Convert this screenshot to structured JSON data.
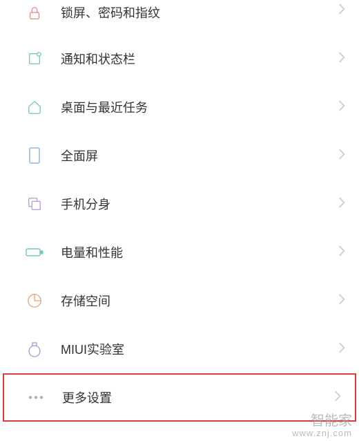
{
  "settings": {
    "items": [
      {
        "label": "锁屏、密码和指纹",
        "icon": "lock-icon"
      },
      {
        "label": "通知和状态栏",
        "icon": "notification-icon"
      },
      {
        "label": "桌面与最近任务",
        "icon": "home-icon"
      },
      {
        "label": "全面屏",
        "icon": "fullscreen-icon"
      },
      {
        "label": "手机分身",
        "icon": "dual-apps-icon"
      },
      {
        "label": "电量和性能",
        "icon": "battery-icon"
      },
      {
        "label": "存储空间",
        "icon": "storage-icon"
      },
      {
        "label": "MIUI实验室",
        "icon": "lab-icon"
      },
      {
        "label": "更多设置",
        "icon": "more-icon",
        "highlighted": true
      }
    ]
  },
  "watermark": {
    "title": "智能家",
    "url": "www.znj.com"
  },
  "colors": {
    "iconTeal": "#7bc8c0",
    "iconBlue": "#8eb8e8",
    "iconPurple": "#b8a0d8",
    "iconOrange": "#e8a878",
    "iconGray": "#b0b0b0",
    "highlight": "#d93a3a"
  }
}
